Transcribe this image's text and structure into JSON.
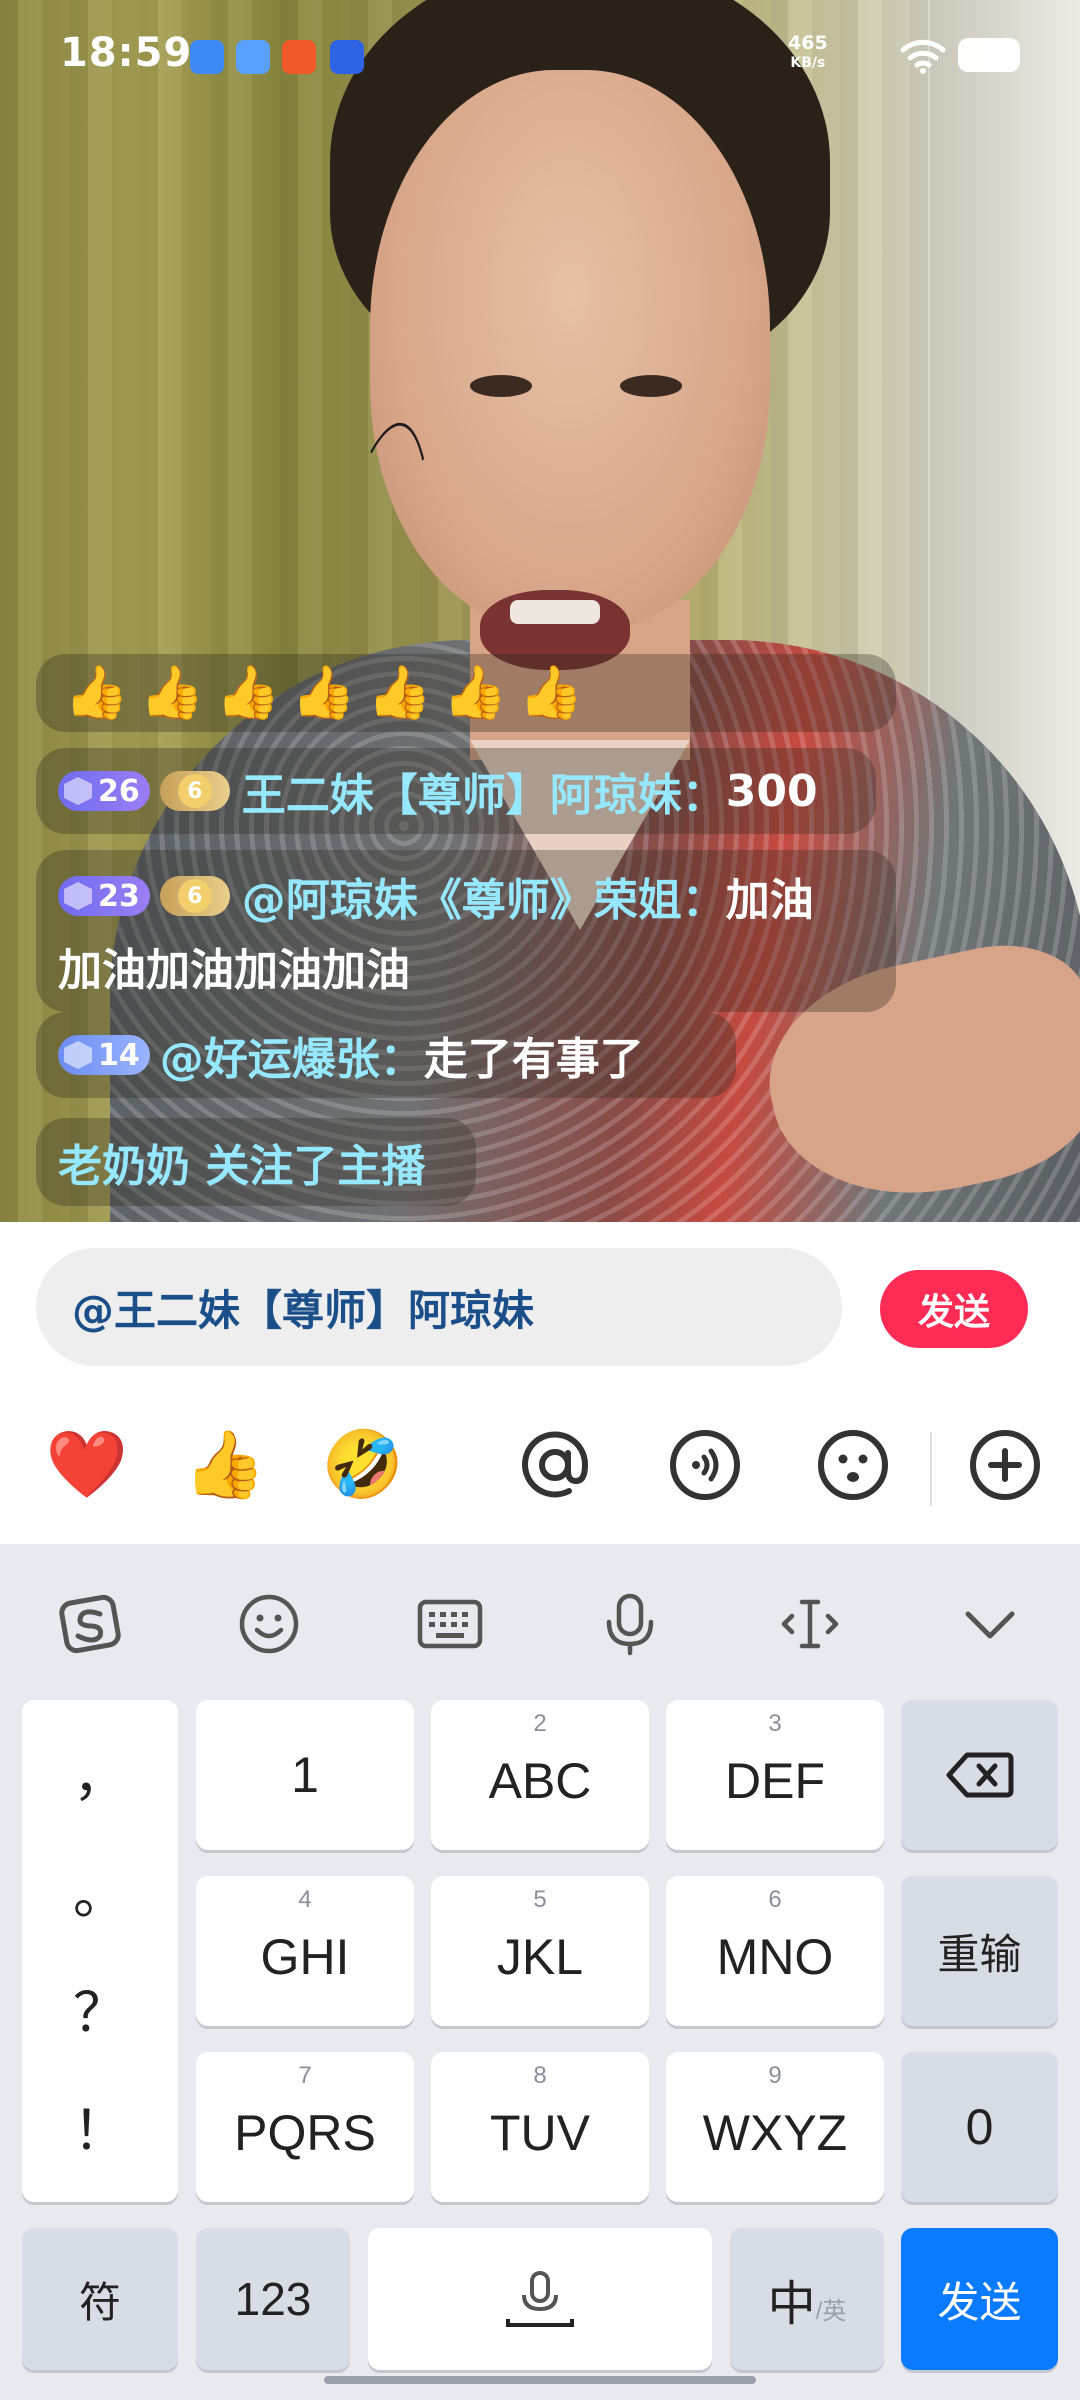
{
  "status_bar": {
    "time": "18:59",
    "net_speed_value": "465",
    "net_speed_unit": "KB/s",
    "app_icons": [
      "notes-app-icon",
      "files-app-icon",
      "pinduoduo-app-icon",
      "vivo-app-icon"
    ]
  },
  "live": {
    "emoji_row": [
      "👍",
      "👍",
      "👍",
      "👍",
      "👍",
      "👍",
      "👍"
    ],
    "comments": [
      {
        "level": "26",
        "fan_level": "6",
        "user": "王二妹【尊师】阿琼妹：",
        "text": "300"
      },
      {
        "level": "23",
        "fan_level": "6",
        "user": "@阿琼妹《尊师》荣姐：",
        "text": "加油",
        "text_line2": "加油加油加油加油"
      },
      {
        "level": "14",
        "user": "@好运爆张：",
        "text": "走了有事了"
      },
      {
        "user": "老奶奶 关注了主播"
      }
    ]
  },
  "input_bar": {
    "value": "@王二妹【尊师】阿琼妹",
    "send_label": "发送"
  },
  "quick_actions": {
    "heart": "❤️",
    "thumb": "👍",
    "laugh": "🤣"
  },
  "keyboard": {
    "punctuation": [
      "，",
      "。",
      "？",
      "！"
    ],
    "keys": [
      {
        "num": "",
        "label": "1"
      },
      {
        "num": "2",
        "label": "ABC"
      },
      {
        "num": "3",
        "label": "DEF"
      },
      {
        "num": "4",
        "label": "GHI"
      },
      {
        "num": "5",
        "label": "JKL"
      },
      {
        "num": "6",
        "label": "MNO"
      },
      {
        "num": "7",
        "label": "PQRS"
      },
      {
        "num": "8",
        "label": "TUV"
      },
      {
        "num": "9",
        "label": "WXYZ"
      }
    ],
    "retype": "重输",
    "zero": "0",
    "symbols": "符",
    "numeric": "123",
    "lang_main": "中",
    "lang_alt": "/英",
    "send": "发送"
  }
}
